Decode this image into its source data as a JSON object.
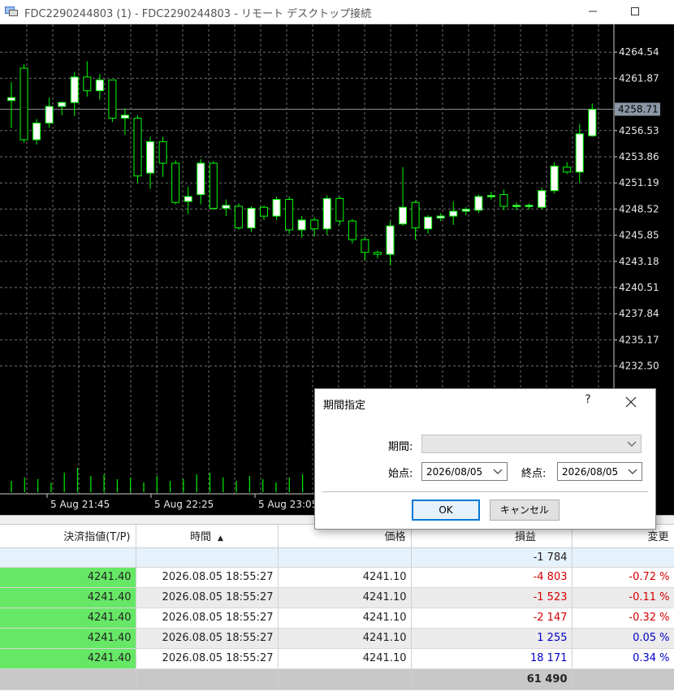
{
  "window": {
    "title": "FDC2290244803 (1) - FDC2290244803 - リモート デスクトップ接続",
    "minimize_icon": "minimize-icon",
    "restore_icon": "restore-icon"
  },
  "chart": {
    "type": "candlestick",
    "price_labels": [
      "4264.54",
      "4261.87",
      "4256.53",
      "4253.86",
      "4251.19",
      "4248.52",
      "4245.85",
      "4243.18",
      "4240.51",
      "4237.84",
      "4235.17",
      "4232.50"
    ],
    "current_price": "4258.71",
    "time_labels": [
      "5 Aug 21:45",
      "5 Aug 22:25",
      "5 Aug 23:05"
    ],
    "y_range": [
      4229.0,
      4268.0
    ],
    "candles": [
      {
        "o": 4259.6,
        "h": 4261.5,
        "l": 4256.8,
        "c": 4259.9
      },
      {
        "o": 4262.9,
        "h": 4263.3,
        "l": 4255.3,
        "c": 4255.6
      },
      {
        "o": 4255.6,
        "h": 4257.7,
        "l": 4255.1,
        "c": 4257.3
      },
      {
        "o": 4257.3,
        "h": 4259.9,
        "l": 4256.8,
        "c": 4259.0
      },
      {
        "o": 4259.0,
        "h": 4259.5,
        "l": 4258.1,
        "c": 4259.4
      },
      {
        "o": 4259.4,
        "h": 4262.5,
        "l": 4258.0,
        "c": 4262.0
      },
      {
        "o": 4262.0,
        "h": 4263.6,
        "l": 4260.0,
        "c": 4260.6
      },
      {
        "o": 4260.6,
        "h": 4262.3,
        "l": 4259.7,
        "c": 4261.7
      },
      {
        "o": 4261.7,
        "h": 4261.7,
        "l": 4257.4,
        "c": 4257.8
      },
      {
        "o": 4257.8,
        "h": 4258.8,
        "l": 4256.1,
        "c": 4258.1
      },
      {
        "o": 4257.8,
        "h": 4258.1,
        "l": 4251.2,
        "c": 4251.9
      },
      {
        "o": 4252.2,
        "h": 4255.9,
        "l": 4250.6,
        "c": 4255.4
      },
      {
        "o": 4255.4,
        "h": 4255.9,
        "l": 4251.8,
        "c": 4253.2
      },
      {
        "o": 4253.2,
        "h": 4253.5,
        "l": 4249.0,
        "c": 4249.2
      },
      {
        "o": 4249.3,
        "h": 4250.8,
        "l": 4248.0,
        "c": 4249.8
      },
      {
        "o": 4250.0,
        "h": 4253.6,
        "l": 4249.0,
        "c": 4253.2
      },
      {
        "o": 4253.2,
        "h": 4253.4,
        "l": 4248.4,
        "c": 4248.6
      },
      {
        "o": 4248.6,
        "h": 4249.5,
        "l": 4247.8,
        "c": 4248.9
      },
      {
        "o": 4248.8,
        "h": 4249.1,
        "l": 4246.4,
        "c": 4246.6
      },
      {
        "o": 4246.6,
        "h": 4248.8,
        "l": 4246.2,
        "c": 4248.6
      },
      {
        "o": 4248.7,
        "h": 4248.9,
        "l": 4247.4,
        "c": 4247.8
      },
      {
        "o": 4247.8,
        "h": 4249.8,
        "l": 4247.4,
        "c": 4249.5
      },
      {
        "o": 4249.5,
        "h": 4249.8,
        "l": 4246.0,
        "c": 4246.4
      },
      {
        "o": 4246.4,
        "h": 4247.8,
        "l": 4245.6,
        "c": 4247.4
      },
      {
        "o": 4247.4,
        "h": 4247.7,
        "l": 4245.7,
        "c": 4246.5
      },
      {
        "o": 4246.5,
        "h": 4249.9,
        "l": 4245.9,
        "c": 4249.6
      },
      {
        "o": 4249.6,
        "h": 4249.8,
        "l": 4246.9,
        "c": 4247.3
      },
      {
        "o": 4247.3,
        "h": 4247.5,
        "l": 4245.0,
        "c": 4245.4
      },
      {
        "o": 4245.4,
        "h": 4245.7,
        "l": 4243.3,
        "c": 4244.1
      },
      {
        "o": 4244.1,
        "h": 4244.3,
        "l": 4243.5,
        "c": 4243.9
      },
      {
        "o": 4243.9,
        "h": 4247.3,
        "l": 4242.8,
        "c": 4246.8
      },
      {
        "o": 4247.0,
        "h": 4252.8,
        "l": 4246.8,
        "c": 4248.7
      },
      {
        "o": 4249.2,
        "h": 4249.4,
        "l": 4245.4,
        "c": 4246.6
      },
      {
        "o": 4246.5,
        "h": 4247.9,
        "l": 4246.0,
        "c": 4247.7
      },
      {
        "o": 4247.6,
        "h": 4248.1,
        "l": 4247.3,
        "c": 4247.8
      },
      {
        "o": 4247.8,
        "h": 4249.3,
        "l": 4246.9,
        "c": 4248.3
      },
      {
        "o": 4248.3,
        "h": 4248.7,
        "l": 4247.9,
        "c": 4248.5
      },
      {
        "o": 4248.4,
        "h": 4250.0,
        "l": 4248.1,
        "c": 4249.8
      },
      {
        "o": 4249.8,
        "h": 4250.3,
        "l": 4249.5,
        "c": 4249.9
      },
      {
        "o": 4250.0,
        "h": 4250.5,
        "l": 4248.4,
        "c": 4248.8
      },
      {
        "o": 4248.8,
        "h": 4249.2,
        "l": 4248.4,
        "c": 4248.9
      },
      {
        "o": 4248.8,
        "h": 4249.1,
        "l": 4248.5,
        "c": 4248.9
      },
      {
        "o": 4248.7,
        "h": 4250.7,
        "l": 4248.5,
        "c": 4250.4
      },
      {
        "o": 4250.4,
        "h": 4253.3,
        "l": 4250.1,
        "c": 4252.9
      },
      {
        "o": 4252.8,
        "h": 4253.3,
        "l": 4252.1,
        "c": 4252.3
      },
      {
        "o": 4252.3,
        "h": 4257.2,
        "l": 4251.2,
        "c": 4256.2
      },
      {
        "o": 4256.0,
        "h": 4259.3,
        "l": 4255.9,
        "c": 4258.7
      }
    ],
    "volumes": [
      0.35,
      0.45,
      0.4,
      0.3,
      0.6,
      0.75,
      0.5,
      0.55,
      0.4,
      0.45,
      0.3,
      0.5,
      0.35,
      0.4,
      0.55,
      0.6,
      0.45,
      0.35,
      0.5,
      0.4,
      0.3,
      0.45,
      0.55,
      0.8,
      0.5,
      0.4,
      0.35,
      0.45,
      0.3,
      0.5,
      0.4,
      0.35
    ]
  },
  "table": {
    "headers": {
      "tp": "決済指値(T/P)",
      "time": "時間",
      "price": "価格",
      "profit": "損益",
      "change": "変更"
    },
    "summary": {
      "profit": "-1 784"
    },
    "rows": [
      {
        "tp": "4241.40",
        "time": "2026.08.05 18:55:27",
        "price": "4241.10",
        "profit": "-4 803",
        "change": "-0.72 %",
        "sign": "neg"
      },
      {
        "tp": "4241.40",
        "time": "2026.08.05 18:55:27",
        "price": "4241.10",
        "profit": "-1 523",
        "change": "-0.11 %",
        "sign": "neg"
      },
      {
        "tp": "4241.40",
        "time": "2026.08.05 18:55:27",
        "price": "4241.10",
        "profit": "-2 147",
        "change": "-0.32 %",
        "sign": "neg"
      },
      {
        "tp": "4241.40",
        "time": "2026.08.05 18:55:27",
        "price": "4241.10",
        "profit": "1 255",
        "change": "0.05 %",
        "sign": "pos"
      },
      {
        "tp": "4241.40",
        "time": "2026.08.05 18:55:27",
        "price": "4241.10",
        "profit": "18 171",
        "change": "0.34 %",
        "sign": "pos"
      }
    ],
    "total": {
      "profit": "61 490"
    }
  },
  "dialog": {
    "title": "期間指定",
    "help": "?",
    "period_label": "期間:",
    "period_value": "",
    "start_label": "始点:",
    "start_value": "2026/08/05",
    "end_label": "終点:",
    "end_value": "2026/08/05",
    "ok_label": "OK",
    "cancel_label": "キャンセル"
  },
  "colors": {
    "bull_body": "#ffffff",
    "bear_body": "#000000",
    "wick": "#00ff00",
    "grid": "#7f7f7f",
    "tp_cell": "#66e866",
    "negative": "#d40000",
    "positive": "#0000c8"
  }
}
